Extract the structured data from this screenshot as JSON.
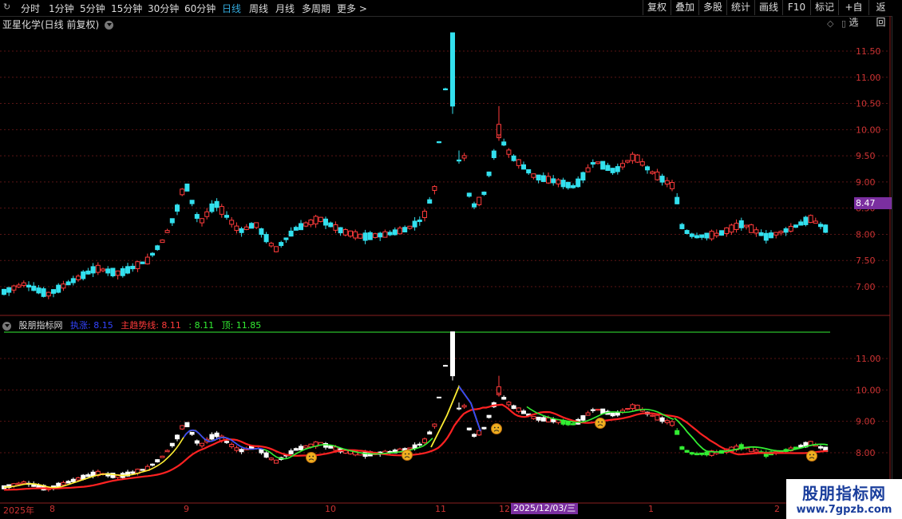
{
  "toolbar": {
    "periods": [
      "分时",
      "1分钟",
      "5分钟",
      "15分钟",
      "30分钟",
      "60分钟",
      "日线",
      "周线",
      "月线",
      "多周期",
      "更多"
    ],
    "active_period": "日线",
    "buttons": [
      "复权",
      "叠加",
      "多股",
      "统计",
      "画线",
      "F10",
      "标记",
      "+自选",
      "返回"
    ]
  },
  "stock_title": "亚星化学(日线 前复权)",
  "current_price_tag": "8.47",
  "main_axis_ticks": [
    "11.50",
    "11.00",
    "10.50",
    "10.00",
    "9.50",
    "9.00",
    "8.50",
    "8.00",
    "7.50",
    "7.00"
  ],
  "indicator": {
    "name": "股朋指标网",
    "label1": "执涨: 8.15",
    "label2": "主趋势线: 8.11",
    "label3": ": 8.11",
    "label4": "顶: 11.85",
    "axis_ticks": [
      "11.00",
      "10.00",
      "9.00",
      "8.00"
    ]
  },
  "date_axis": {
    "labels": [
      "2025年",
      "8",
      "9",
      "10",
      "11",
      "12",
      "1",
      "2"
    ],
    "highlighted_date": "2025/12/03/三"
  },
  "watermark": {
    "line1": "股朋指标网",
    "line2": "www.7gpzb.com"
  },
  "colors": {
    "up": "#ff3b3b",
    "down": "#33e0ee",
    "ma_red": "#ff2222",
    "ma_yellow": "#ffee33",
    "ma_blue": "#3344ff",
    "ma_green": "#33ee33",
    "accent": "#7b2fa0"
  }
}
